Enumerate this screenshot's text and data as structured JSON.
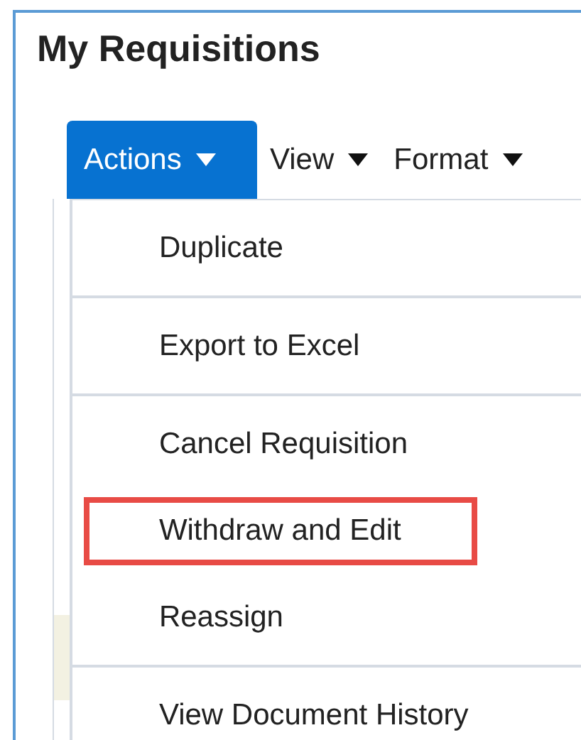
{
  "panel": {
    "title": "My Requisitions"
  },
  "toolbar": [
    {
      "label": "Actions",
      "selected": true
    },
    {
      "label": "View",
      "selected": false
    },
    {
      "label": "Format",
      "selected": false
    }
  ],
  "menu": {
    "groups": [
      [
        {
          "label": "Duplicate",
          "highlighted": false
        }
      ],
      [
        {
          "label": "Export to Excel",
          "highlighted": false
        }
      ],
      [
        {
          "label": "Cancel Requisition",
          "highlighted": false
        },
        {
          "label": "Withdraw and Edit",
          "highlighted": true
        },
        {
          "label": "Reassign",
          "highlighted": false
        }
      ],
      [
        {
          "label": "View Document History",
          "highlighted": false
        }
      ]
    ]
  }
}
